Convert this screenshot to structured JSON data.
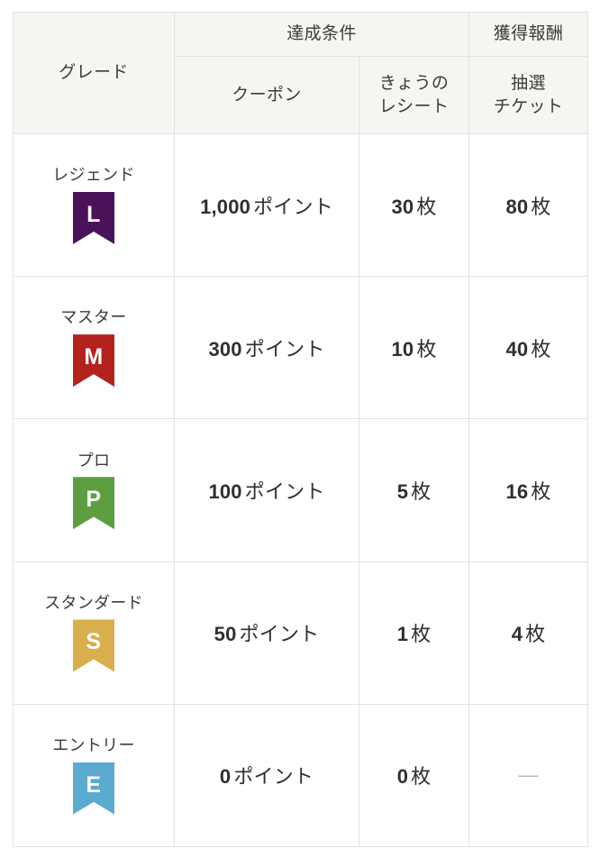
{
  "table": {
    "headers": {
      "grade": "グレード",
      "condition_group": "達成条件",
      "reward_group": "獲得報酬",
      "coupon": "クーポン",
      "receipt": "きょうの\nレシート",
      "receipt_line1": "きょうの",
      "receipt_line2": "レシート",
      "ticket": "抽選\nチケット",
      "ticket_line1": "抽選",
      "ticket_line2": "チケット"
    },
    "rows": [
      {
        "grade_name": "レジェンド",
        "badge_letter": "L",
        "badge_color": "#4a1259",
        "coupon_num": "1,000",
        "coupon_unit": "ポイント",
        "receipt_num": "30",
        "receipt_unit": "枚",
        "ticket_num": "80",
        "ticket_unit": "枚"
      },
      {
        "grade_name": "マスター",
        "badge_letter": "M",
        "badge_color": "#b4221e",
        "coupon_num": "300",
        "coupon_unit": "ポイント",
        "receipt_num": "10",
        "receipt_unit": "枚",
        "ticket_num": "40",
        "ticket_unit": "枚"
      },
      {
        "grade_name": "プロ",
        "badge_letter": "P",
        "badge_color": "#5d9e42",
        "coupon_num": "100",
        "coupon_unit": "ポイント",
        "receipt_num": "5",
        "receipt_unit": "枚",
        "ticket_num": "16",
        "ticket_unit": "枚"
      },
      {
        "grade_name": "スタンダード",
        "badge_letter": "S",
        "badge_color": "#d9ae4c",
        "coupon_num": "50",
        "coupon_unit": "ポイント",
        "receipt_num": "1",
        "receipt_unit": "枚",
        "ticket_num": "4",
        "ticket_unit": "枚"
      },
      {
        "grade_name": "エントリー",
        "badge_letter": "E",
        "badge_color": "#5baad0",
        "coupon_num": "0",
        "coupon_unit": "ポイント",
        "receipt_num": "0",
        "receipt_unit": "枚",
        "ticket_num": "",
        "ticket_unit": "",
        "ticket_empty": "—"
      }
    ]
  },
  "style": {
    "header_bg": "#f6f5f1",
    "border_color": "#e4e2de",
    "body_bg": "#ffffff",
    "text_color": "#333333",
    "dash_color": "#b8b8b8"
  }
}
